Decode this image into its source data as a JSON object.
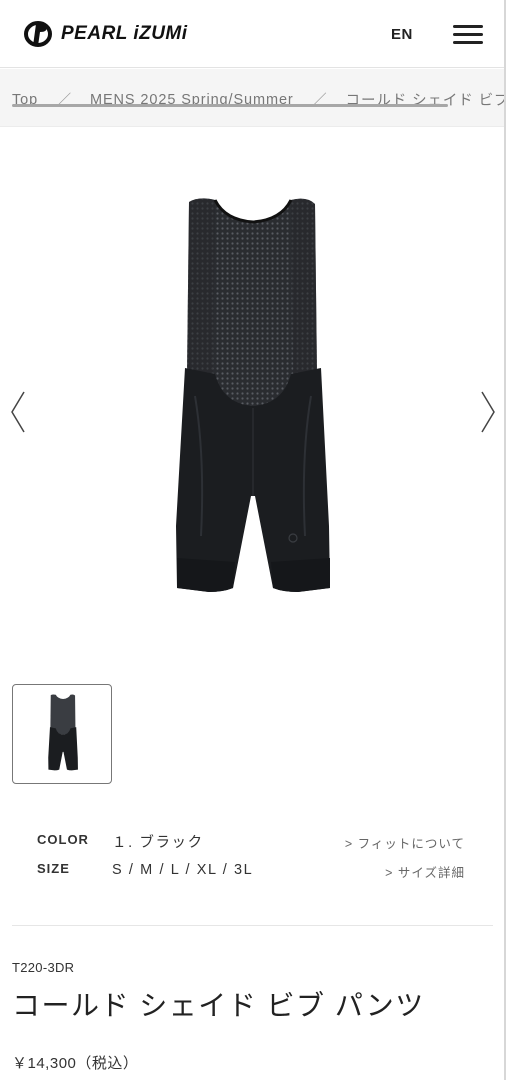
{
  "header": {
    "brand": "PEARL iZUMi",
    "language": "EN"
  },
  "breadcrumb": [
    {
      "label": "Top"
    },
    {
      "label": "MENS 2025 Spring/Summer"
    },
    {
      "label": "コールド シェイド ビブ パンツ"
    }
  ],
  "breadcrumb_separator": "／",
  "product": {
    "color_label": "COLOR",
    "color_value": "１. ブラック",
    "fit_link": "> フィットについて",
    "size_label": "SIZE",
    "size_value": "S / M / L / XL / 3L",
    "size_link": "> サイズ詳細",
    "code": "T220-3DR",
    "name": "コールド シェイド ビブ パンツ",
    "price": "￥14,300（税込）"
  },
  "colors": {
    "garment": "#1b1d20",
    "mesh": "#3c3f44",
    "accent": "#222222"
  },
  "icons": [
    "pearl-izumi-logo-icon",
    "hamburger-menu-icon",
    "chevron-left-icon",
    "chevron-right-icon"
  ]
}
